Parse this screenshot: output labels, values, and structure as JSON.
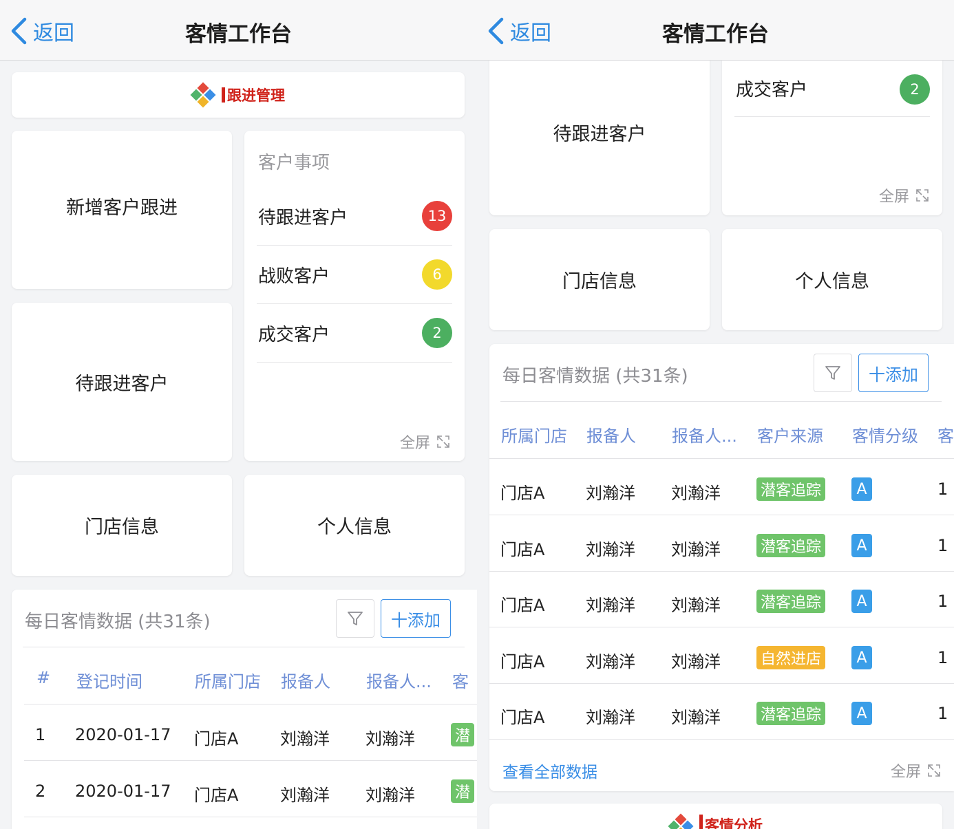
{
  "nav": {
    "back_label": "返回",
    "title": "客情工作台"
  },
  "sections": {
    "follow_up": "跟进管理",
    "analysis": "客情分析"
  },
  "tiles": {
    "new_follow_up": "新增客户跟进",
    "pending_customers": "待跟进客户",
    "store_info": "门店信息",
    "personal_info": "个人信息"
  },
  "customer_matters": {
    "title": "客户事项",
    "items": [
      {
        "label": "待跟进客户",
        "count": "13",
        "color": "#e8403b"
      },
      {
        "label": "战败客户",
        "count": "6",
        "color": "#f2d92c"
      },
      {
        "label": "成交客户",
        "count": "2",
        "color": "#4caf60"
      }
    ],
    "fullscreen_label": "全屏"
  },
  "daily_data": {
    "title": "每日客情数据 (共31条)",
    "add_label": "十添加",
    "view_all_label": "查看全部数据",
    "fullscreen_label": "全屏",
    "headers": {
      "index": "#",
      "reg_time": "登记时间",
      "store": "所属门店",
      "reporter": "报备人",
      "reporter2": "报备人...",
      "source": "客户来源",
      "grade": "客情分级",
      "cut_left": "客",
      "cut_right": "客"
    },
    "left_rows": [
      {
        "index": "1",
        "time": "2020-01-17",
        "store": "门店A",
        "reporter": "刘瀚洋",
        "reporter2": "刘瀚洋",
        "source_cut": "潜"
      },
      {
        "index": "2",
        "time": "2020-01-17",
        "store": "门店A",
        "reporter": "刘瀚洋",
        "reporter2": "刘瀚洋",
        "source_cut": "潜"
      }
    ],
    "right_rows": [
      {
        "store": "门店A",
        "reporter": "刘瀚洋",
        "reporter2": "刘瀚洋",
        "source": "潜客追踪",
        "grade": "A",
        "cut": "1"
      },
      {
        "store": "门店A",
        "reporter": "刘瀚洋",
        "reporter2": "刘瀚洋",
        "source": "潜客追踪",
        "grade": "A",
        "cut": "1"
      },
      {
        "store": "门店A",
        "reporter": "刘瀚洋",
        "reporter2": "刘瀚洋",
        "source": "潜客追踪",
        "grade": "A",
        "cut": "1"
      },
      {
        "store": "门店A",
        "reporter": "刘瀚洋",
        "reporter2": "刘瀚洋",
        "source": "自然进店",
        "grade": "A",
        "cut": "1"
      },
      {
        "store": "门店A",
        "reporter": "刘瀚洋",
        "reporter2": "刘瀚洋",
        "source": "潜客追踪",
        "grade": "A",
        "cut": "1"
      }
    ]
  },
  "colors": {
    "accent": "#3a8ee6",
    "tag_green": "#6fc46a",
    "tag_orange": "#f5b631",
    "grade_blue": "#3a9ee8",
    "brand_red": "#d0231b"
  },
  "icons": {
    "back": "chevron-left-icon",
    "filter": "filter-icon",
    "fullscreen": "expand-icon",
    "logo": "diamond-logo-icon"
  }
}
